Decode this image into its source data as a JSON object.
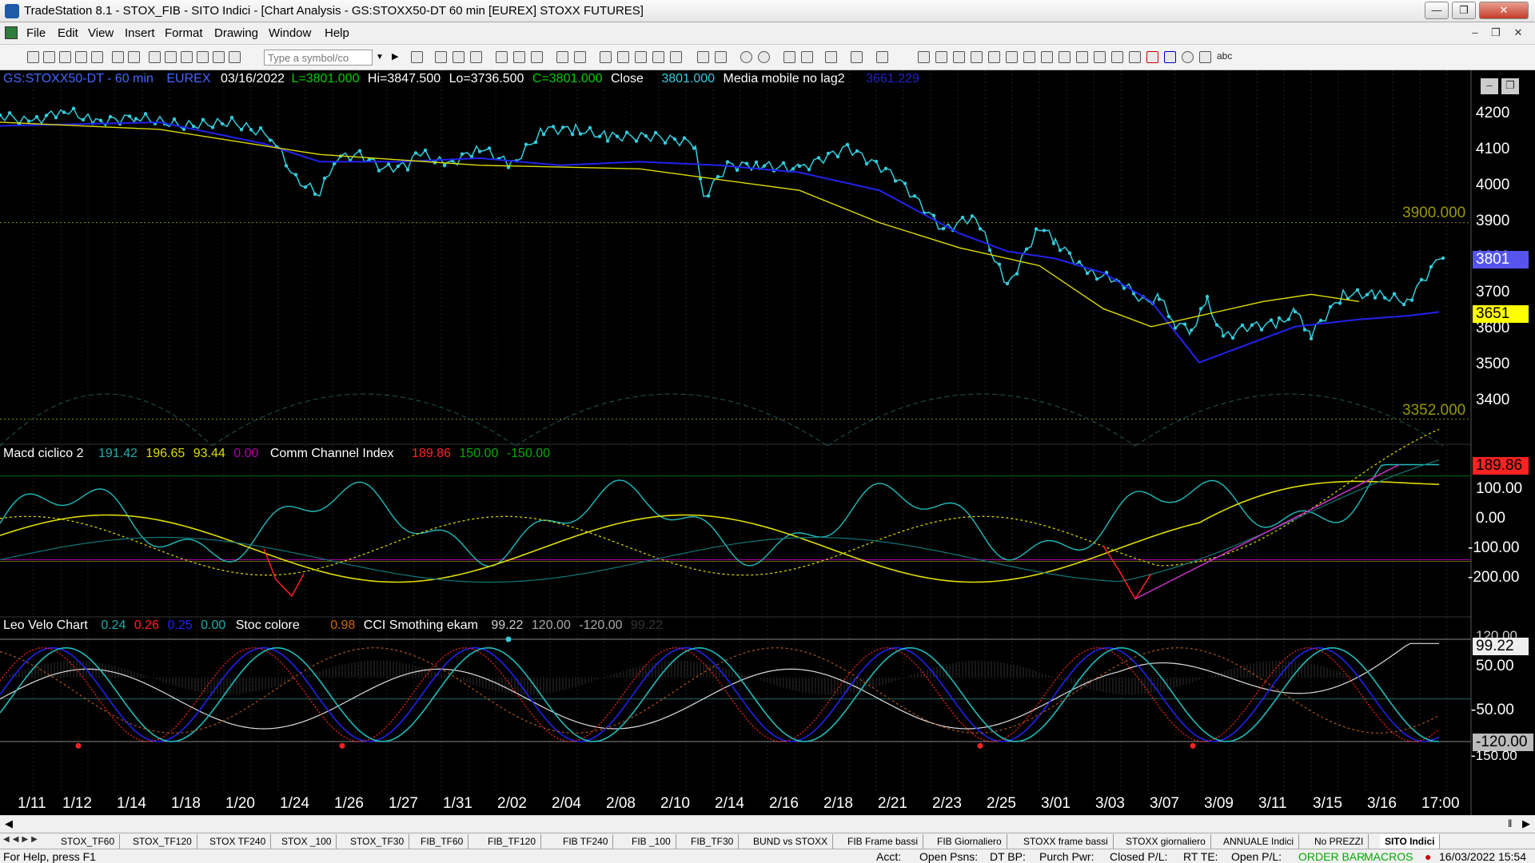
{
  "window": {
    "title": "TradeStation 8.1 - STOX_FIB - SITO Indici - [Chart Analysis - GS:STOXX50-DT  60 min  [EUREX] STOXX FUTURES]"
  },
  "menu": [
    "File",
    "Edit",
    "View",
    "Insert",
    "Format",
    "Drawing",
    "Window",
    "Help"
  ],
  "toolbar": {
    "symbol_placeholder": "Type a symbol/co",
    "text_tool": "abc"
  },
  "price_panel": {
    "symbol": "GS:STOXX50-DT - 60 min",
    "exchange": "EUREX",
    "date": "03/16/2022",
    "last": "L=3801.000",
    "high": "Hi=3847.500",
    "low": "Lo=3736.500",
    "close": "C=3801.000",
    "close_label": "Close",
    "close_value": "3801.000",
    "ma_label": "Media mobile no lag2",
    "ma_value": "3661.229",
    "y_ticks": [
      "4200",
      "4100",
      "4000",
      "3900",
      "3800",
      "3700",
      "3600",
      "3500",
      "3400"
    ],
    "line_3900": "3900.000",
    "line_3352": "3352.000",
    "last_badge": "3801",
    "ma_badge": "3651"
  },
  "macd_panel": {
    "name": "Macd ciclico 2",
    "v1": "191.42",
    "v2": "196.65",
    "v3": "93.44",
    "v4": "0.00",
    "cci_name": "Comm Channel Index",
    "cci_value": "189.86",
    "cci_upper": "150.00",
    "cci_lower": "-150.00",
    "y_ticks": [
      "100.00",
      "0.00",
      "-100.00",
      "-200.00"
    ],
    "badge": "189.86"
  },
  "leo_panel": {
    "name": "Leo Velo Chart",
    "v1": "0.24",
    "v2": "0.26",
    "v3": "0.25",
    "v4": "0.00",
    "stoc_name": "Stoc colore",
    "stoc_value": "0.98",
    "cci_name": "CCI Smothing ekam",
    "cci_value": "99.22",
    "cci_upper": "120.00",
    "cci_lower": "-120.00",
    "cci_last": "99.22",
    "y_ticks": [
      "120.00",
      "50.00",
      "-50.00",
      "-150.00"
    ],
    "badge_value": "99.22",
    "badge_lower": "-120.00"
  },
  "x_axis": [
    "1/11",
    "1/12",
    "1/14",
    "1/18",
    "1/20",
    "1/24",
    "1/26",
    "1/27",
    "1/31",
    "2/02",
    "2/04",
    "2/08",
    "2/10",
    "2/14",
    "2/16",
    "2/18",
    "2/21",
    "2/23",
    "2/25",
    "3/01",
    "3/03",
    "3/07",
    "3/09",
    "3/11",
    "3/15",
    "3/16",
    "17:00"
  ],
  "tabs": [
    "STOX_TF60",
    "STOX_TF120",
    "STOX TF240",
    "STOX _100",
    "STOX_TF30",
    "FIB_TF60",
    "FIB_TF120",
    "FIB TF240",
    "FIB _100",
    "FIB_TF30",
    "BUND vs STOXX",
    "FIB Frame bassi",
    "FIB Giornaliero",
    "STOXX frame bassi",
    "STOXX giornaliero",
    "ANNUALE Indici",
    "No PREZZI",
    "SITO Indici"
  ],
  "status": {
    "help": "For Help, press F1",
    "acct": "Acct:",
    "open_psns": "Open Psns:",
    "dt_bp": "DT BP:",
    "purch_pwr": "Purch Pwr:",
    "closed_pl": "Closed P/L:",
    "rt_te": "RT TE:",
    "open_pl": "Open P/L:",
    "order_bar": "ORDER BAR",
    "macros": "MACROS",
    "datetime": "16/03/2022 15:54"
  },
  "colors": {
    "price_dots": "#33ccdd",
    "ma_blue": "#2222ee",
    "ma_yellow": "#dddd00",
    "cci_cyan": "#22bbbb",
    "trend_magenta": "#cc33cc",
    "red": "#ff2222",
    "level_line": "#888800"
  }
}
